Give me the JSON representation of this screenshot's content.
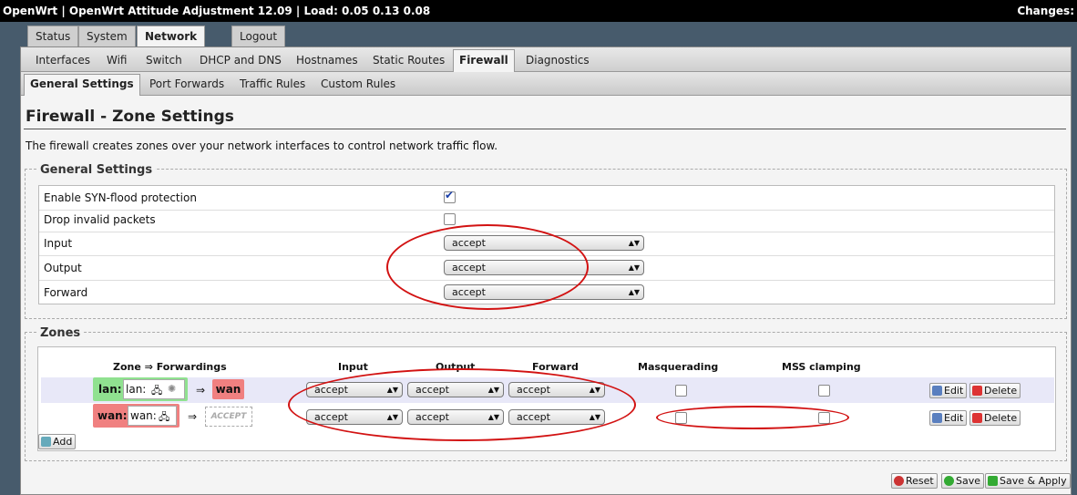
{
  "topbar": {
    "title": "OpenWrt | OpenWrt Attitude Adjustment 12.09 | Load: 0.05 0.13 0.08",
    "changes": "Changes:"
  },
  "maintabs": {
    "status": "Status",
    "system": "System",
    "network": "Network",
    "logout": "Logout"
  },
  "subtabs": {
    "interfaces": "Interfaces",
    "wifi": "Wifi",
    "switch": "Switch",
    "dhcp": "DHCP and DNS",
    "hostnames": "Hostnames",
    "routes": "Static Routes",
    "firewall": "Firewall",
    "diagnostics": "Diagnostics"
  },
  "fwtabs": {
    "general": "General Settings",
    "portfw": "Port Forwards",
    "traffic": "Traffic Rules",
    "custom": "Custom Rules"
  },
  "page": {
    "title": "Firewall - Zone Settings",
    "description": "The firewall creates zones over your network interfaces to control network traffic flow."
  },
  "general": {
    "legend": "General Settings",
    "synflood_label": "Enable SYN-flood protection",
    "synflood_checked": true,
    "dropinvalid_label": "Drop invalid packets",
    "dropinvalid_checked": false,
    "input_label": "Input",
    "input_value": "accept",
    "output_label": "Output",
    "output_value": "accept",
    "forward_label": "Forward",
    "forward_value": "accept"
  },
  "zones": {
    "legend": "Zones",
    "headers": {
      "zone": "Zone ⇒ Forwardings",
      "input": "Input",
      "output": "Output",
      "forward": "Forward",
      "masq": "Masquerading",
      "mss": "MSS clamping"
    },
    "rows": [
      {
        "name": "lan:",
        "iface": "lan:",
        "arrow": "⇒",
        "dest": "wan",
        "input": "accept",
        "output": "accept",
        "forward": "accept",
        "edit": "Edit",
        "delete": "Delete",
        "masq": false,
        "mss": false
      },
      {
        "name": "wan:",
        "iface": "wan:",
        "arrow": "⇒",
        "dest": "ACCEPT",
        "input": "accept",
        "output": "accept",
        "forward": "accept",
        "edit": "Edit",
        "delete": "Delete",
        "masq": false,
        "mss": false
      }
    ],
    "add_label": "Add"
  },
  "actions": {
    "reset": "Reset",
    "save": "Save",
    "apply": "Save & Apply"
  },
  "colors": {
    "lan": "#90e190",
    "wan": "#f08080",
    "highlight": "#d21212"
  }
}
